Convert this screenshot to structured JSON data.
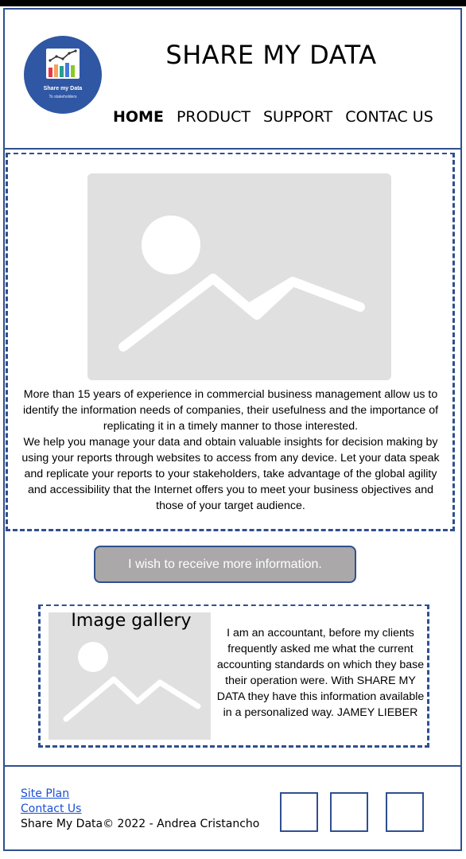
{
  "header": {
    "title": "SHARE MY DATA",
    "logo": {
      "name": "Share my Data",
      "tagline": "To stakeholders"
    },
    "nav": [
      {
        "label": "HOME",
        "active": true
      },
      {
        "label": "PRODUCT",
        "active": false
      },
      {
        "label": "SUPPORT",
        "active": false
      },
      {
        "label": "CONTAC US",
        "active": false
      }
    ]
  },
  "hero": {
    "image_icon": "image-placeholder-icon",
    "paragraph1": "More than 15 years of experience in commercial business management allow us to identify the information needs of companies, their usefulness and the importance of replicating it in a timely manner to those interested.",
    "paragraph2": "We help you manage your data and obtain valuable insights for decision making by using your reports through websites to access from any device.   Let your data speak and replicate your reports to your stakeholders, take advantage of the global agility and accessibility that the Internet offers you to meet your business objectives and those of your target audience."
  },
  "cta": {
    "label": "I wish to receive more information."
  },
  "testimonial": {
    "gallery_title": "Image gallery",
    "text": "I am an accountant, before my clients frequently asked me what the current accounting standards on which they base their operation were. With SHARE MY DATA they have this information available in a personalized way. JAMEY LIEBER"
  },
  "footer": {
    "links": [
      "Site Plan",
      "Contact Us"
    ],
    "copyright": "Share My Data© 2022 - Andrea Cristancho",
    "social_icons": [
      "social-icon",
      "social-icon",
      "social-icon"
    ]
  },
  "colors": {
    "border": "#2f4f8f",
    "logo_bg": "#2f57a3",
    "cta_bg": "#aaa8a8",
    "placeholder": "#e0e0e0",
    "link": "#1a4fd6"
  }
}
